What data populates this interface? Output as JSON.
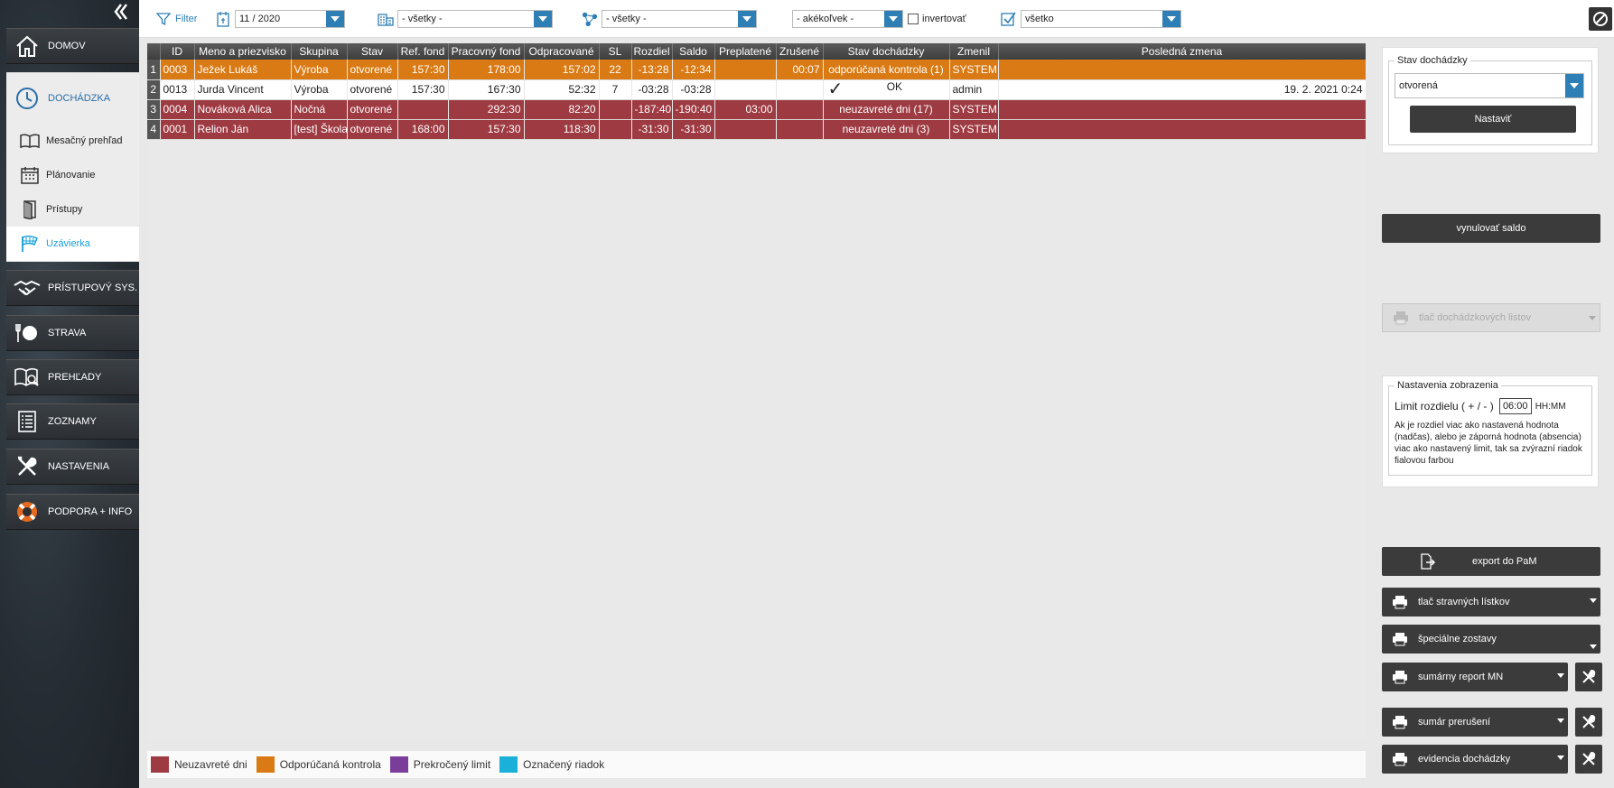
{
  "sidebar": {
    "sections": [
      {
        "label": "DOMOV",
        "icon": "home-icon"
      },
      {
        "label": "PRÍSTUPOVÝ SYS.",
        "icon": "handshake-icon"
      },
      {
        "label": "STRAVA",
        "icon": "plate-icon"
      },
      {
        "label": "PREHĽADY",
        "icon": "book-search-icon"
      },
      {
        "label": "ZOZNAMY",
        "icon": "list-icon"
      },
      {
        "label": "NASTAVENIA",
        "icon": "tools-icon"
      },
      {
        "label": "PODPORA + INFO",
        "icon": "lifebuoy-icon"
      }
    ],
    "dochadzka": {
      "label": "DOCHÁDZKA",
      "items": [
        {
          "label": "Mesačný prehľad"
        },
        {
          "label": "Plánovanie"
        },
        {
          "label": "Prístupy"
        },
        {
          "label": "Uzávierka"
        }
      ]
    }
  },
  "toolbar": {
    "filter_label": "Filter",
    "month_value": "11 / 2020",
    "department_value": "- všetky -",
    "group_value": "- všetky -",
    "any_value": "- akékoľvek -",
    "invert_label": "invertovať",
    "scope_value": "všetko"
  },
  "grid": {
    "columns": [
      "ID",
      "Meno a priezvisko",
      "Skupina",
      "Stav",
      "Ref. fond",
      "Pracovný fond",
      "Odpracované",
      "SL",
      "Rozdiel",
      "Saldo",
      "Preplatené",
      "Zrušené",
      "Stav dochádzky",
      "Zmenil",
      "Posledná zmena"
    ],
    "rows": [
      {
        "n": "1",
        "id": "0003",
        "name": "Ježek Lukáš",
        "group": "Výroba",
        "state": "otvorené",
        "ref": "157:30",
        "work": "178:00",
        "done": "157:02",
        "sl": "22",
        "diff": "-13:28",
        "saldo": "-12:34",
        "paid": "",
        "cancel": "00:07",
        "att": "odporúčaná kontrola (1)",
        "changed": "SYSTEM",
        "last": "",
        "check": ""
      },
      {
        "n": "2",
        "id": "0013",
        "name": "Jurda Vincent",
        "group": "Výroba",
        "state": "otvorené",
        "ref": "157:30",
        "work": "167:30",
        "done": "52:32",
        "sl": "7",
        "diff": "-03:28",
        "saldo": "-03:28",
        "paid": "",
        "cancel": "",
        "att": "OK",
        "changed": "admin",
        "last": "19. 2. 2021 0:24",
        "check": "✓"
      },
      {
        "n": "3",
        "id": "0004",
        "name": "Nováková Alica",
        "group": "Nočná",
        "state": "otvorené",
        "ref": "",
        "work": "292:30",
        "done": "82:20",
        "sl": "",
        "diff": "-187:40",
        "saldo": "-190:40",
        "paid": "03:00",
        "cancel": "",
        "att": "neuzavreté dni (17)",
        "changed": "SYSTEM",
        "last": "",
        "check": ""
      },
      {
        "n": "4",
        "id": "0001",
        "name": "Relion Ján",
        "group": "[test] Škola",
        "state": "otvorené",
        "ref": "168:00",
        "work": "157:30",
        "done": "118:30",
        "sl": "",
        "diff": "-31:30",
        "saldo": "-31:30",
        "paid": "",
        "cancel": "",
        "att": "neuzavreté dni (3)",
        "changed": "SYSTEM",
        "last": "",
        "check": ""
      }
    ]
  },
  "legend": [
    {
      "label": "Neuzavreté dni",
      "color": "#9e3a42"
    },
    {
      "label": "Odporúčaná kontrola",
      "color": "#d97a14"
    },
    {
      "label": "Prekročený limit",
      "color": "#7a3e9a"
    },
    {
      "label": "Označený riadok",
      "color": "#1ab0d8"
    }
  ],
  "right": {
    "stav_legend": "Stav dochádzky",
    "stav_value": "otvorená",
    "set_button": "Nastaviť",
    "reset_saldo": "vynulovať saldo",
    "print_attendance": "tlač dochádzkových listov",
    "display_legend": "Nastavenia zobrazenia",
    "limit_label": "Limit rozdielu ( + / - )",
    "limit_value": "06:00",
    "limit_unit": "HH:MM",
    "limit_help": "Ak je rozdiel viac ako nastavená hodnota (nadčas), alebo je záporná hodnota (absencia) viac ako nastavený limit, tak sa zvýrazní riadok fialovou farbou",
    "export": "export do PaM",
    "meal_tickets": "tlač stravných lístkov",
    "special": "špeciálne zostavy",
    "summary_mn": "sumárny report MN",
    "interruptions": "sumár prerušení",
    "evidence": "evidencia dochádzky"
  },
  "colors": {
    "accent": "#2e7fb5",
    "orange": "#d97a14",
    "red": "#9e3a42"
  }
}
